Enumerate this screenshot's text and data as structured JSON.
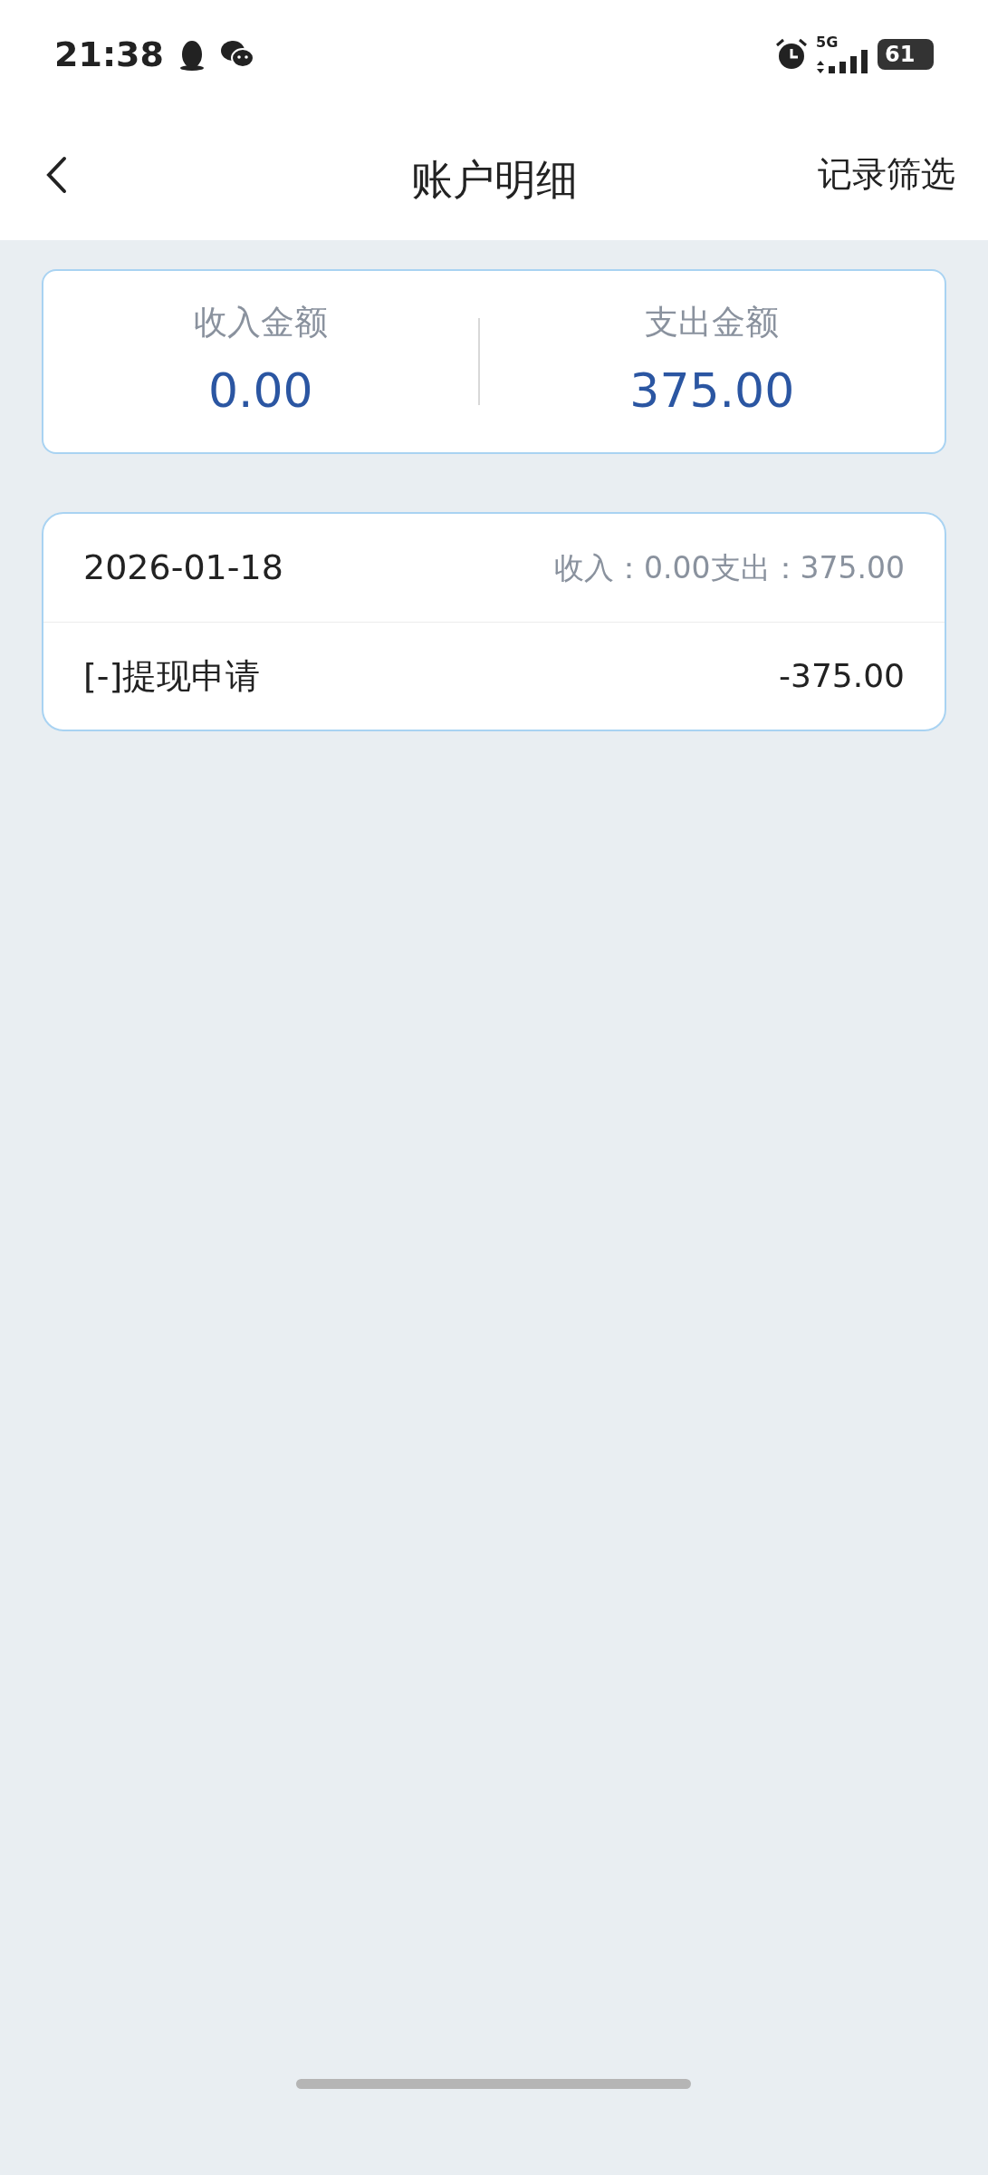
{
  "status_bar": {
    "time": "21:38",
    "network": "5G",
    "battery": "61"
  },
  "header": {
    "title": "账户明细",
    "action": "记录筛选"
  },
  "summary": [
    {
      "label": "收入金额",
      "value": "0.00"
    },
    {
      "label": "支出金额",
      "value": "375.00"
    }
  ],
  "days": [
    {
      "date": "2026-01-18",
      "totals": "收入：0.00支出：375.00",
      "records": [
        {
          "name": "[-]提现申请",
          "amount": "-375.00"
        }
      ]
    }
  ]
}
